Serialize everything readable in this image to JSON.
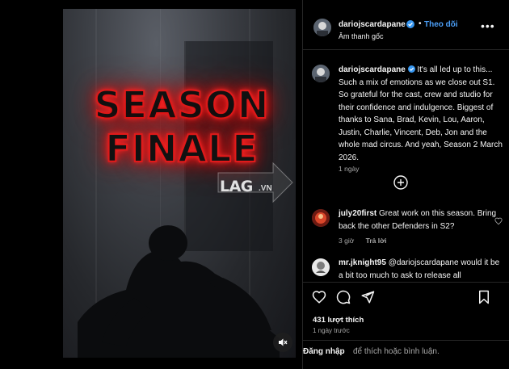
{
  "post": {
    "author": "dariojscardapane",
    "follow_label": "Theo dõi",
    "separator": "•",
    "audio": "Âm thanh gốc",
    "more_label": "•••",
    "caption": "It's all led up to this... Such a mix of emotions as we close out S1. So grateful for the cast, crew and studio for their confidence and indulgence. Biggest of thanks to Sana, Brad, Kevin, Lou, Aaron, Justin, Charlie, Vincent, Deb, Jon and the whole mad circus. And yeah, Season 2 March 2026.",
    "caption_time": "1 ngày",
    "likes": "431 lượt thích",
    "date": "1 ngày trước"
  },
  "video": {
    "title_line1": "SEASON",
    "title_line2": "FINALE",
    "watermark": "LAG",
    "watermark_suffix": ".VN"
  },
  "comments": [
    {
      "username": "july20first",
      "text": "Great work on this season. Bring back the other Defenders in S2?",
      "time": "3 giờ",
      "reply_label": "Trả lời"
    },
    {
      "username": "mr.jknight95",
      "text": "@dariojscardapane would it be a bit too much to ask to release all",
      "time": "",
      "reply_label": ""
    }
  ],
  "login": {
    "link": "Đăng nhập",
    "rest": "để thích hoặc bình luận."
  },
  "colors": {
    "accent": "#4b9ff8",
    "neon_red": "#e01a1a",
    "background": "#000000"
  },
  "icons": [
    "verified-badge-icon",
    "more-options-icon",
    "load-more-plus-icon",
    "heart-icon",
    "comment-icon",
    "share-icon",
    "bookmark-icon",
    "mute-icon"
  ]
}
